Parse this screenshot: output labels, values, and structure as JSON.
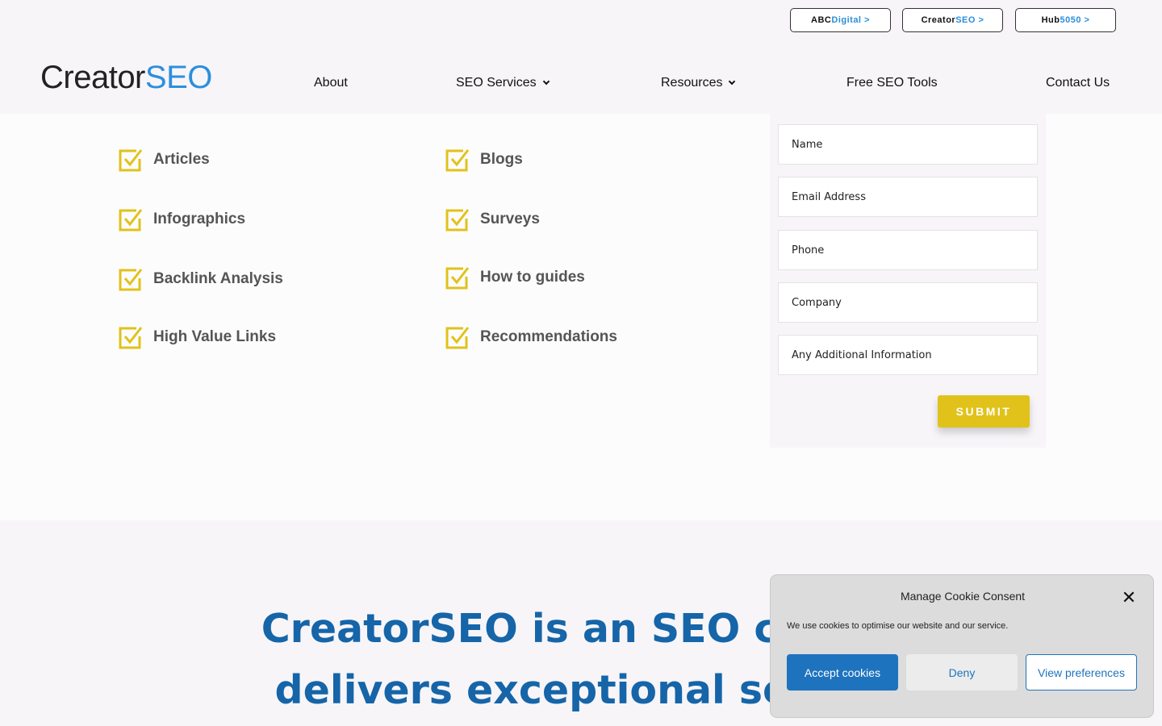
{
  "network_links": [
    {
      "prefix": "ABC",
      "highlight": "Digital >"
    },
    {
      "prefix": "Creator",
      "highlight": "SEO >"
    },
    {
      "prefix": "Hub",
      "highlight": "5050 >"
    }
  ],
  "logo": {
    "part1": "Creator",
    "part2": "SEO"
  },
  "nav": {
    "about": "About",
    "seo_services": "SEO Services",
    "resources": "Resources",
    "free_tools": "Free SEO Tools",
    "contact": "Contact Us"
  },
  "checklist": {
    "left": [
      "Articles",
      "Infographics",
      "Backlink Analysis",
      "High Value Links"
    ],
    "right": [
      "Blogs",
      "Surveys",
      "How to guides",
      "Recommendations"
    ]
  },
  "form": {
    "name": "Name",
    "email": "Email Address",
    "phone": "Phone",
    "company": "Company",
    "additional": "Any Additional Information",
    "submit": "SUBMIT"
  },
  "headline": {
    "line1": "CreatorSEO is an SEO compa",
    "line2": "delivers exceptional search"
  },
  "cookie": {
    "title": "Manage Cookie Consent",
    "close": "✕",
    "text": "We use cookies to optimise our website and our service.",
    "accept": "Accept cookies",
    "deny": "Deny",
    "preferences": "View preferences"
  },
  "colors": {
    "accent_blue": "#1e73be",
    "logo_blue": "#2d8fdc",
    "check_yellow": "#e1c21a",
    "headline_blue": "#1565a8"
  }
}
